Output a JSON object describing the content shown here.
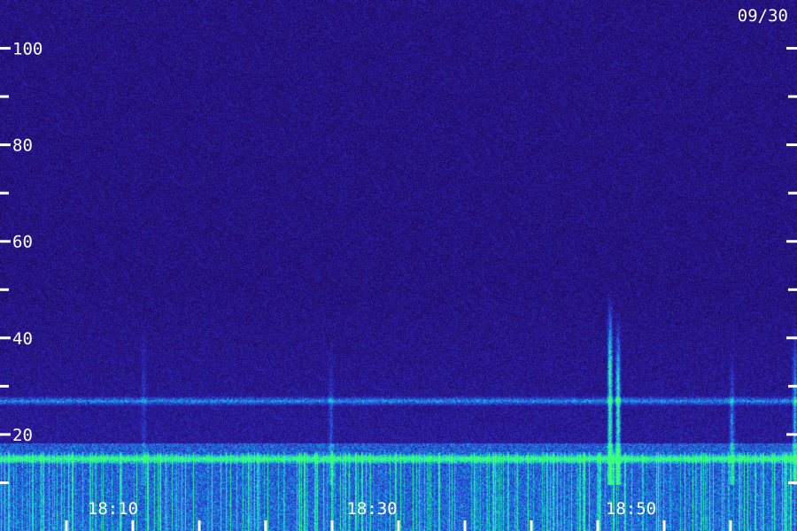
{
  "chart_data": {
    "type": "heatmap",
    "title": "",
    "xlabel": "",
    "ylabel": "",
    "ylim": [
      0,
      110
    ],
    "y_ticks_major": [
      20,
      40,
      60,
      80,
      100
    ],
    "y_tick_labels": [
      "20",
      "40",
      "60",
      "80",
      "100"
    ],
    "y_ticks_minor": [
      10,
      30,
      50,
      70,
      90
    ],
    "x_tick_labels": [
      "18:10",
      "18:30",
      "18:50"
    ],
    "date_label": "09/30",
    "grid": false,
    "legend": "none",
    "colormap": [
      "#1a0a55",
      "#2a1590",
      "#2a35c8",
      "#1e7fe0",
      "#19d0d8",
      "#3dff7a"
    ],
    "features": {
      "noise_floor_level": 0.15,
      "horizontal_bands": [
        {
          "y": 27,
          "intensity": 0.55
        },
        {
          "y": 15,
          "intensity": 0.75
        }
      ],
      "vertical_bursts": [
        {
          "position": 0.765,
          "y_top": 50,
          "intensity": 1.0
        },
        {
          "position": 0.775,
          "y_top": 46,
          "intensity": 0.9
        },
        {
          "position": 0.918,
          "y_top": 38,
          "intensity": 0.5
        },
        {
          "position": 0.997,
          "y_top": 44,
          "intensity": 0.6
        },
        {
          "position": 0.415,
          "y_top": 40,
          "intensity": 0.3
        },
        {
          "position": 0.18,
          "y_top": 45,
          "intensity": 0.2
        }
      ]
    }
  }
}
